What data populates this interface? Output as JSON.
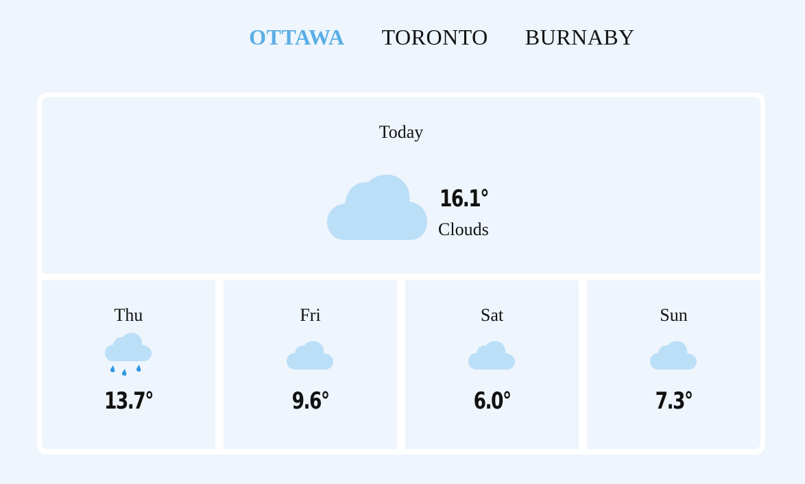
{
  "nav": {
    "cities": [
      "OTTAWA",
      "TORONTO",
      "BURNABY"
    ],
    "active_index": 0
  },
  "colors": {
    "background": "#eef5fc",
    "accent": "#5aaee6",
    "cloud": "#bcdff8",
    "rain": "#2f96e0"
  },
  "today": {
    "label": "Today",
    "temp": "16.1°",
    "description": "Clouds",
    "icon": "cloud-icon"
  },
  "forecast": [
    {
      "day": "Thu",
      "temp": "13.7°",
      "icon": "rain-cloud-icon"
    },
    {
      "day": "Fri",
      "temp": "9.6°",
      "icon": "cloud-icon"
    },
    {
      "day": "Sat",
      "temp": "6.0°",
      "icon": "cloud-icon"
    },
    {
      "day": "Sun",
      "temp": "7.3°",
      "icon": "cloud-icon"
    }
  ]
}
